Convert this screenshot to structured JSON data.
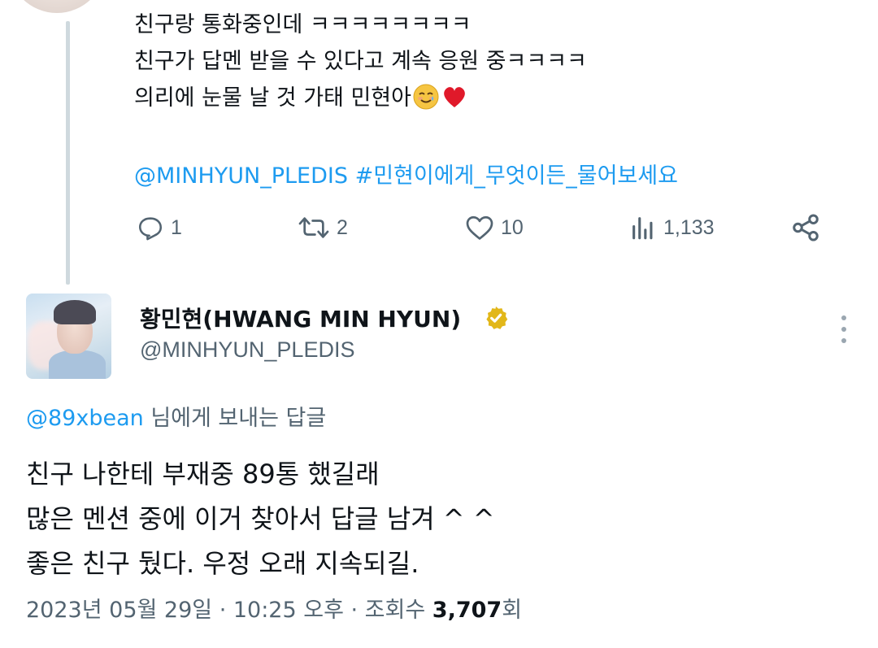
{
  "original_tweet": {
    "lines": [
      "친구랑 통화중인데 ㅋㅋㅋㅋㅋㅋㅋㅋ",
      "친구가 답멘 받을 수 있다고 계속 응원 중ㅋㅋㅋㅋ",
      "의리에 눈물 날 것 가태 민현아"
    ],
    "emojis": [
      "smiling-face-with-tear",
      "red-heart"
    ],
    "tags": "@MINHYUN_PLEDIS #민현이에게_무엇이든_물어보세요",
    "actions": {
      "reply_count": "1",
      "retweet_count": "2",
      "like_count": "10",
      "view_count": "1,133"
    }
  },
  "reply": {
    "display_name": "황민현(HWANG MIN HYUN)",
    "handle": "@MINHYUN_PLEDIS",
    "verified": true,
    "replying_to_handle": "@89xbean",
    "replying_to_suffix": " 님에게 보내는 답글",
    "lines": [
      "친구 나한테 부재중 89통 했길래",
      "많은 멘션 중에 이거 찾아서 답글 남겨 ^ ^",
      "좋은 친구 뒀다. 우정 오래 지속되길."
    ],
    "timestamp": "2023년 05월 29일 · 10:25 오후 · 조회수 ",
    "views": "3,707",
    "views_suffix": "회"
  },
  "colors": {
    "accent": "#1d9bf0",
    "muted": "#536471",
    "text": "#0f1419",
    "verified_gold": "#e2b719",
    "thread_line": "#cfd9de"
  },
  "icons": [
    "reply-icon",
    "retweet-icon",
    "like-icon",
    "views-icon",
    "share-icon",
    "verified-badge-icon",
    "more-icon"
  ]
}
